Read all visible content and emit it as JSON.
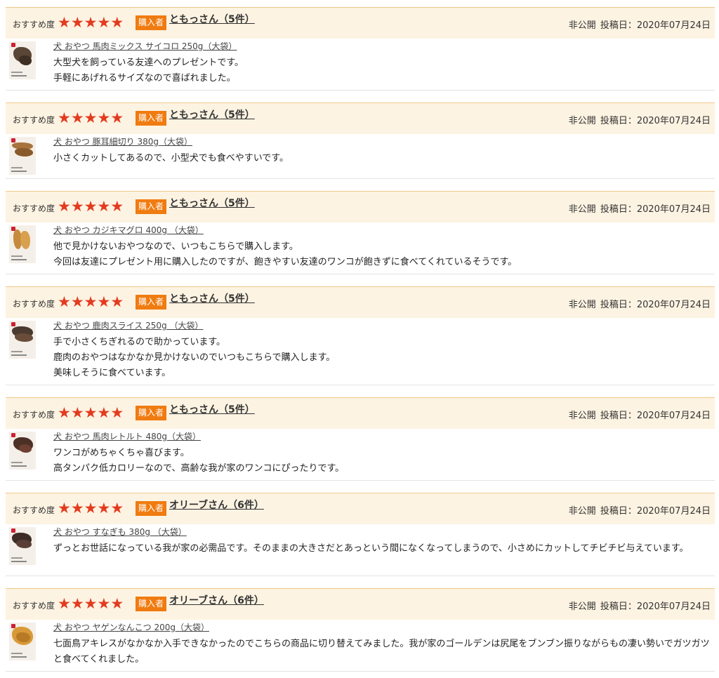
{
  "labels": {
    "recommend": "おすすめ度",
    "star": "★",
    "buyer_badge": "購入者",
    "privacy": "非公開",
    "posted_prefix": "投稿日："
  },
  "colors": {
    "star": "#e33b1f",
    "badge": "#f07b10",
    "header_bg": "#fdf3e2"
  },
  "reviews": [
    {
      "reviewer": "ともっさん（5件）",
      "rating": 5,
      "date": "2020年07月24日",
      "product": "犬 おやつ 馬肉ミックス サイコロ 250g（大袋）",
      "lines": [
        "大型犬を飼っている友達へのプレゼントです。",
        "手軽にあげれるサイズなので喜ばれました。"
      ]
    },
    {
      "reviewer": "ともっさん（5件）",
      "rating": 5,
      "date": "2020年07月24日",
      "product": "犬 おやつ 豚耳細切り 380g（大袋）",
      "lines": [
        "小さくカットしてあるので、小型犬でも食べやすいです。"
      ]
    },
    {
      "reviewer": "ともっさん（5件）",
      "rating": 5,
      "date": "2020年07月24日",
      "product": "犬 おやつ カジキマグロ 400g （大袋）",
      "lines": [
        "他で見かけないおやつなので、いつもこちらで購入します。",
        "今回は友達にプレゼント用に購入したのですが、飽きやすい友達のワンコが飽きずに食べてくれているそうです。"
      ]
    },
    {
      "reviewer": "ともっさん（5件）",
      "rating": 5,
      "date": "2020年07月24日",
      "product": "犬 おやつ 鹿肉スライス 250g （大袋）",
      "lines": [
        "手で小さくちぎれるので助かっています。",
        "鹿肉のおやつはなかなか見かけないのでいつもこちらで購入します。",
        "美味しそうに食べています。"
      ]
    },
    {
      "reviewer": "ともっさん（5件）",
      "rating": 5,
      "date": "2020年07月24日",
      "product": "犬 おやつ 馬肉レトルト 480g（大袋）",
      "lines": [
        "ワンコがめちゃくちゃ喜びます。",
        "高タンパク低カロリーなので、高齢な我が家のワンコにぴったりです。"
      ]
    },
    {
      "reviewer": "オリーブさん（6件）",
      "rating": 5,
      "date": "2020年07月24日",
      "product": "犬 おやつ すなぎも 380g （大袋）",
      "lines": [
        "ずっとお世話になっている我が家の必需品です。そのままの大きさだとあっという間になくなってしまうので、小さめにカットしてチビチビ与えています。"
      ]
    },
    {
      "reviewer": "オリーブさん（6件）",
      "rating": 5,
      "date": "2020年07月24日",
      "product": "犬 おやつ ヤゲンなんこつ 200g（大袋）",
      "lines": [
        "七面鳥アキレスがなかなか入手できなかったのでこちらの商品に切り替えてみました。我が家のゴールデンは尻尾をブンブン振りながらもの凄い勢いでガツガツと食べてくれました。"
      ]
    }
  ]
}
